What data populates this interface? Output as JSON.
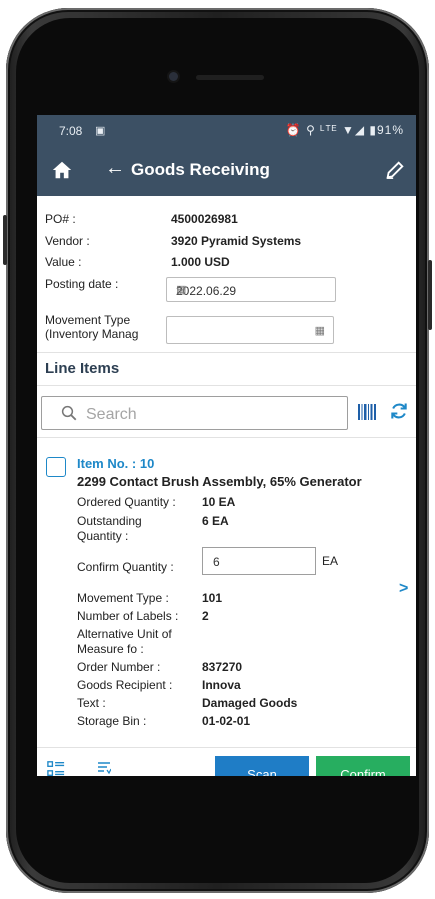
{
  "status": {
    "time": "7:08",
    "right": "⏰ ⚲ ᴸᵀᴱ ▼◢ ▮91%"
  },
  "appbar": {
    "title": "Goods Receiving"
  },
  "header": {
    "po_label": "PO# :",
    "po_value": "4500026981",
    "vendor_label": "Vendor :",
    "vendor_value": "3920 Pyramid Systems",
    "value_label": "Value :",
    "value_value": "1.000 USD",
    "posting_label": "Posting date :",
    "posting_value": "2022.06.29",
    "movement_label_1": "Movement Type",
    "movement_label_2": "(Inventory Manag",
    "movement_value": ""
  },
  "line_items": {
    "title": "Line Items",
    "search_placeholder": "Search"
  },
  "item": {
    "no_label": "Item No. :  10",
    "description": "2299 Contact Brush Assembly, 65% Generator",
    "ordered_label": "Ordered Quantity :",
    "ordered_value": "10 EA",
    "outstanding_label_1": "Outstanding",
    "outstanding_label_2": "Quantity :",
    "outstanding_value": "6 EA",
    "confirm_label": "Confirm Quantity :",
    "confirm_value": "6",
    "confirm_unit": "EA",
    "movement_label": "Movement Type :",
    "movement_value": "101",
    "labels_label": "Number of Labels :",
    "labels_value": "2",
    "alt_unit_label_1": "Alternative Unit of",
    "alt_unit_label_2": "Measure fo :",
    "order_label": "Order Number :",
    "order_value": "837270",
    "recipient_label": "Goods Recipient :",
    "recipient_value": "Innova",
    "text_label": "Text :",
    "text_value": "Damaged Goods",
    "bin_label": "Storage Bin :",
    "bin_value": "01-02-01"
  },
  "buttons": {
    "scan": "Scan",
    "confirm": "Confirm"
  },
  "colors": {
    "bar": "#3c5064",
    "accent": "#1e88c8",
    "scan": "#1f7dc6",
    "confirm": "#27ae60"
  },
  "icons": [
    "home-icon",
    "back-arrow-icon",
    "edit-icon",
    "calendar-icon",
    "search-icon",
    "barcode-icon",
    "refresh-icon",
    "chevron-right-icon",
    "list-view-icon",
    "filter-list-icon"
  ]
}
